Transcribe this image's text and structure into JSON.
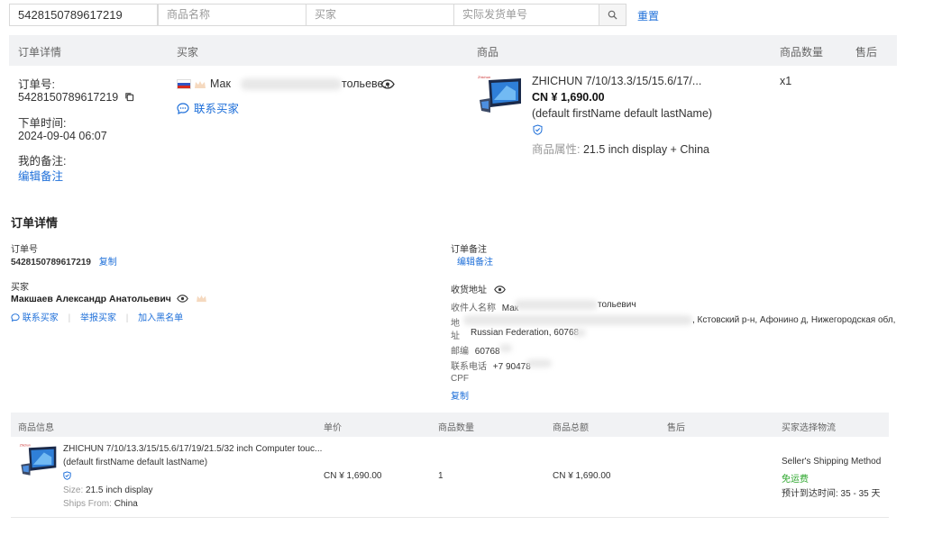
{
  "search": {
    "order_no_value": "5428150789617219",
    "product_placeholder": "商品名称",
    "buyer_placeholder": "买家",
    "shipment_placeholder": "实际发货单号",
    "reset_label": "重置"
  },
  "order_table": {
    "headers": [
      "订单详情",
      "买家",
      "商品",
      "商品数量",
      "售后"
    ],
    "order_no_label": "订单号:",
    "order_no": "5428150789617219",
    "order_time_label": "下单时间:",
    "order_time": "2024-09-04 06:07",
    "note_label": "我的备注:",
    "edit_note": "编辑备注",
    "buyer_name_start": "Мак",
    "buyer_name_end": "тольеве...",
    "contact_buyer": "联系买家",
    "product_title": "ZHICHUN 7/10/13.3/15/15.6/17/...",
    "price": "CN ¥ 1,690.00",
    "variant_name": "(default firstName default lastName)",
    "attr_label": "商品属性:",
    "attr_value": "21.5 inch display + China",
    "quantity": "x1"
  },
  "detail": {
    "section_title": "订单详情",
    "order_no_label": "订单号",
    "order_no": "5428150789617219",
    "copy": "复制",
    "buyer_label": "买家",
    "buyer_full_name": "Макшаев Александр Анатольевич",
    "contact_buyer": "联系买家",
    "report_buyer": "举报买家",
    "blacklist": "加入黑名单",
    "order_note_label": "订单备注",
    "edit_note": "编辑备注",
    "address_title": "收货地址",
    "recipient_label": "收件人名称",
    "recipient_start": "Мак",
    "recipient_end": "тольевич",
    "address_label_1": "地",
    "address_label_2": "址",
    "address_line1_end": ", Кстовский р-н, Афонино д, Нижегородская обл,",
    "address_line2": "Russian Federation, 60768",
    "zip_label": "邮编",
    "zip_value": "60768",
    "phone_label": "联系电话",
    "phone_value": "+7 90478",
    "cpf_label": "CPF",
    "copy_address": "复制"
  },
  "items_table": {
    "headers": [
      "商品信息",
      "单价",
      "商品数量",
      "商品总额",
      "售后",
      "买家选择物流"
    ],
    "product_title": "ZHICHUN 7/10/13.3/15/15.6/17/19/21.5/32 inch Computer touc...",
    "variant_name": "(default firstName default lastName)",
    "size_label": "Size:",
    "size_value": "21.5 inch display",
    "ships_label": "Ships From:",
    "ships_value": "China",
    "unit_price": "CN ¥ 1,690.00",
    "quantity": "1",
    "total": "CN ¥ 1,690.00",
    "shipping_method": "Seller's Shipping Method",
    "free_shipping": "免运费",
    "eta": "预计到达时间: 35 - 35 天"
  },
  "colors": {
    "link": "#1e6fd9",
    "free_shipping": "#2aa52a",
    "header_bg": "#f1f2f4"
  }
}
